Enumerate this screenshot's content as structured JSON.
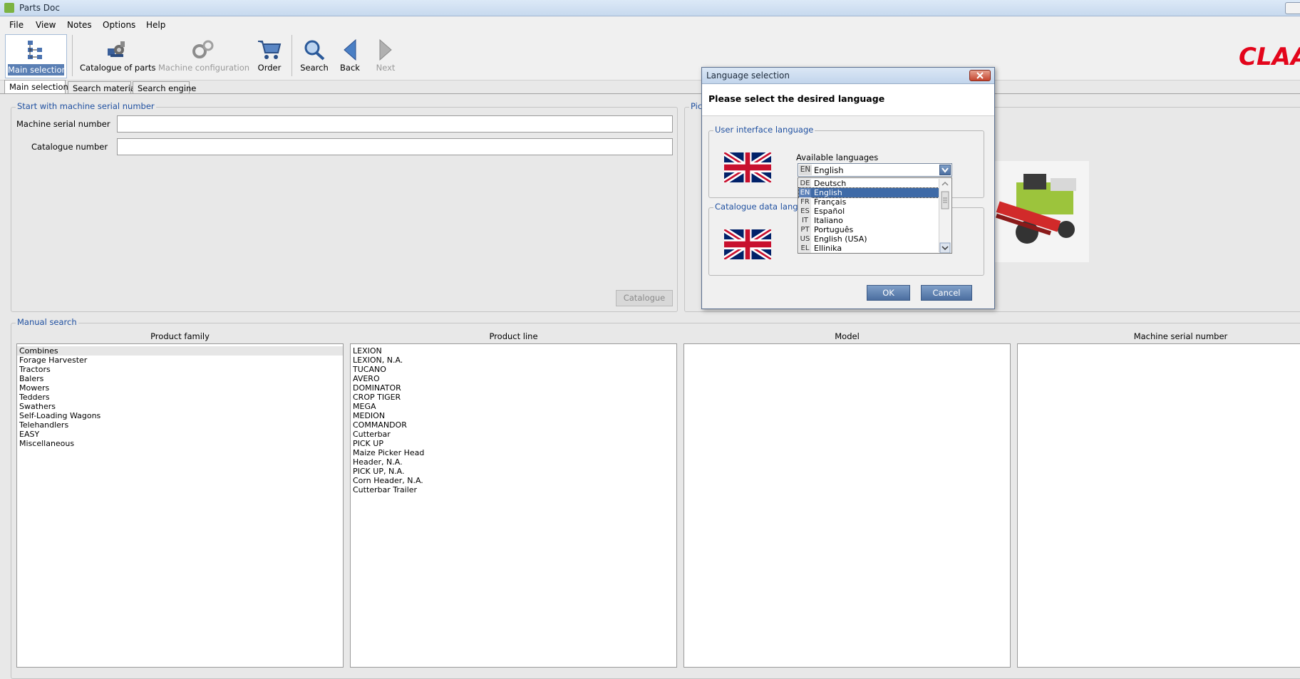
{
  "window": {
    "title": "Parts Doc"
  },
  "menu": [
    "File",
    "View",
    "Notes",
    "Options",
    "Help"
  ],
  "toolbar": {
    "main_selection": "Main selection",
    "catalogue_of_parts": "Catalogue of parts",
    "machine_configuration": "Machine configuration",
    "order": "Order",
    "search": "Search",
    "back": "Back",
    "next": "Next"
  },
  "brand": {
    "logo_text": "CLAAS",
    "color": "#e3051b"
  },
  "tabs": [
    "Main selection",
    "Search material",
    "Search engine"
  ],
  "serial_group": {
    "legend": "Start with machine serial number",
    "serial_label": "Machine serial number",
    "serial_value": "",
    "catalogue_label": "Catalogue number",
    "catalogue_value": "",
    "catalogue_button": "Catalogue"
  },
  "picture_group": {
    "legend": "Pict"
  },
  "manual_search": {
    "legend": "Manual search",
    "columns": [
      "Product family",
      "Product line",
      "Model",
      "Machine serial number"
    ],
    "product_family": [
      "Combines",
      "Forage Harvester",
      "Tractors",
      "Balers",
      "Mowers",
      "Tedders",
      "Swathers",
      "Self-Loading Wagons",
      "Telehandlers",
      "EASY",
      "Miscellaneous"
    ],
    "product_line": [
      "LEXION",
      "LEXION, N.A.",
      "TUCANO",
      "AVERO",
      "DOMINATOR",
      "CROP TIGER",
      "MEGA",
      "MEDION",
      "COMMANDOR",
      "Cutterbar",
      "PICK UP",
      "Maize Picker Head",
      "Header, N.A.",
      "PICK UP, N.A.",
      "Corn Header, N.A.",
      "Cutterbar Trailer"
    ]
  },
  "dialog": {
    "title": "Language selection",
    "heading": "Please select the desired language",
    "ui_group": "User interface language",
    "available_label": "Available languages",
    "selected": {
      "code": "EN",
      "name": "English"
    },
    "data_group": "Catalogue data langua",
    "languages": [
      {
        "code": "DE",
        "name": "Deutsch"
      },
      {
        "code": "EN",
        "name": "English"
      },
      {
        "code": "FR",
        "name": "Français"
      },
      {
        "code": "ES",
        "name": "Español"
      },
      {
        "code": "IT",
        "name": "Italiano"
      },
      {
        "code": "PT",
        "name": "Português"
      },
      {
        "code": "US",
        "name": "English (USA)"
      },
      {
        "code": "EL",
        "name": "Ellinika"
      }
    ],
    "ok": "OK",
    "cancel": "Cancel"
  },
  "icons": [
    "main-selection-icon",
    "catalogue-icon",
    "gears-icon",
    "cart-icon",
    "magnifier-icon",
    "back-arrow-icon",
    "next-arrow-icon",
    "uk-flag-icon",
    "close-icon",
    "chevron-down-icon"
  ]
}
